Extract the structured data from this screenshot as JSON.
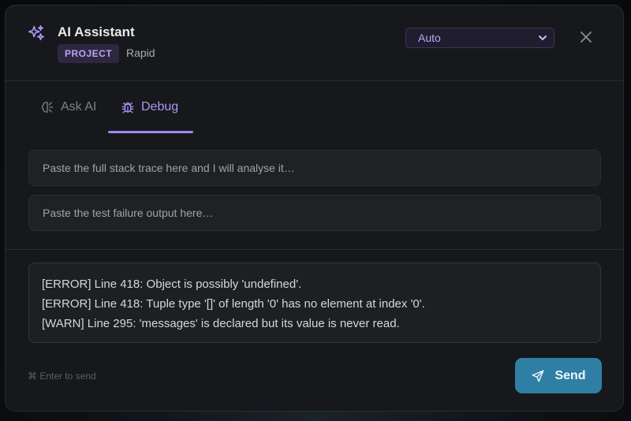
{
  "header": {
    "title": "AI Assistant",
    "badge": "PROJECT",
    "project_name": "Rapid",
    "model_selected": "Auto"
  },
  "tabs": [
    {
      "label": "Ask AI",
      "icon": "brain-icon",
      "active": false
    },
    {
      "label": "Debug",
      "icon": "bug-icon",
      "active": true
    }
  ],
  "inputs": {
    "stack_trace_placeholder": "Paste the full stack trace here and I will analyse it…",
    "test_failure_placeholder": "Paste the test failure output here…"
  },
  "output": {
    "lines": [
      "[ERROR] Line 418: Object is possibly 'undefined'.",
      "[ERROR] Line 418: Tuple type '[]' of length '0' has no element at index '0'.",
      "[WARN] Line 295: 'messages' is declared but its value is never read."
    ]
  },
  "footer": {
    "hint": "⌘ Enter to send",
    "send_label": "Send"
  },
  "colors": {
    "accent_purple": "#a996f7",
    "send_blue": "#2f7fa4",
    "panel_bg": "#17181b"
  }
}
